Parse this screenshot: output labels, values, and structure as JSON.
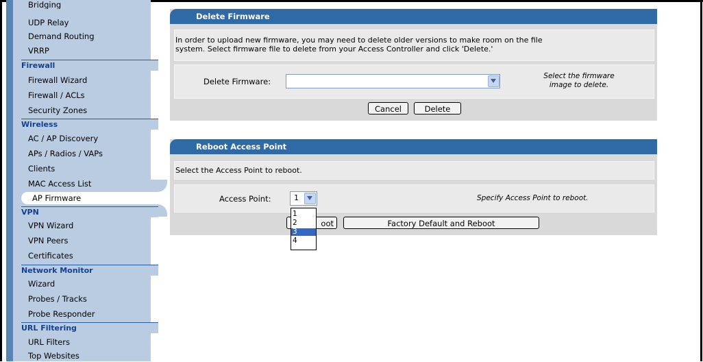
{
  "sidebar": {
    "items_top": [
      "Bridging",
      "UDP Relay",
      "Demand Routing",
      "VRRP"
    ],
    "firewall": {
      "heading": "Firewall",
      "items": [
        "Firewall Wizard",
        "Firewall / ACLs",
        "Security Zones"
      ]
    },
    "wireless": {
      "heading": "Wireless",
      "items": [
        "AC / AP Discovery",
        "APs / Radios / VAPs",
        "Clients",
        "MAC Access List",
        "AP Firmware"
      ]
    },
    "vpn": {
      "heading": "VPN",
      "items": [
        "VPN Wizard",
        "VPN Peers",
        "Certificates"
      ]
    },
    "network_monitor": {
      "heading": "Network Monitor",
      "items": [
        "Wizard",
        "Probes / Tracks",
        "Probe Responder"
      ]
    },
    "url_filtering": {
      "heading": "URL Filtering",
      "items": [
        "URL Filters",
        "Top Websites"
      ]
    }
  },
  "delete_firmware": {
    "title": "Delete Firmware",
    "description_line1": "In order to upload new firmware, you may need to delete older versions to make room on the file",
    "description_line2": "system. Select firmware file to delete from your Access Controller and click 'Delete.'",
    "field_label": "Delete Firmware:",
    "selected_value": "",
    "hint_line1": "Select the firmware",
    "hint_line2": "image to delete.",
    "cancel_label": "Cancel",
    "delete_label": "Delete"
  },
  "reboot_ap": {
    "title": "Reboot Access Point",
    "description": "Select the Access Point to reboot.",
    "field_label": "Access Point:",
    "selected_value": "1",
    "options": [
      "1",
      "2",
      "3",
      "4"
    ],
    "highlighted_option": "3",
    "hint": "Specify Access Point to reboot.",
    "reboot_label_visible": "oot",
    "factory_label": "Factory Default and Reboot"
  },
  "colors": {
    "header_blue": "#2f69a6",
    "sidebar_bg": "#b9cce2",
    "sidebar_heading": "#12408f",
    "selection": "#316ac5"
  }
}
